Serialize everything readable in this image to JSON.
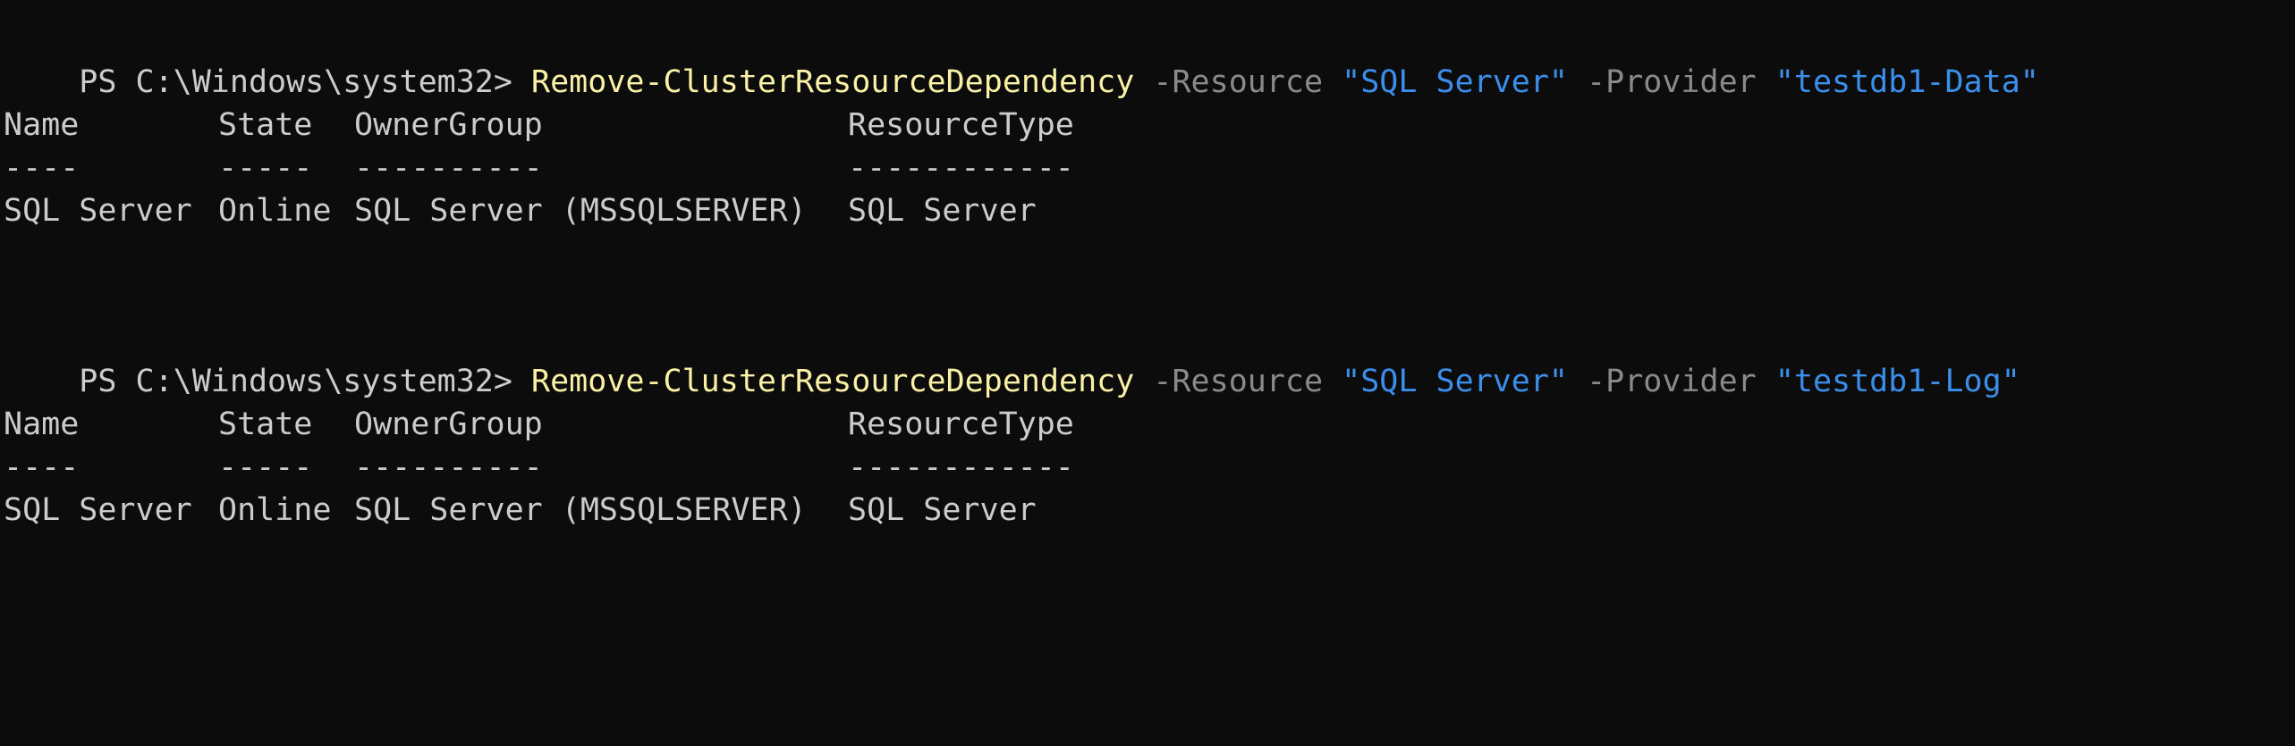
{
  "theme": {
    "background": "#0c0c0c",
    "text": "#cccccc",
    "command": "#f9f1a5",
    "parameter": "#8a8a8a",
    "string": "#3b8eea"
  },
  "blocks": [
    {
      "prompt": "PS C:\\Windows\\system32>",
      "command": "Remove-ClusterResourceDependency",
      "param1": "-Resource",
      "arg1": "\"SQL Server\"",
      "param2": "-Provider",
      "arg2": "\"testdb1-Data\"",
      "headers": [
        "Name",
        "State",
        "OwnerGroup",
        "ResourceType"
      ],
      "dashes": [
        "----",
        "-----",
        "----------",
        "------------"
      ],
      "row": [
        "SQL Server",
        "Online",
        "SQL Server (MSSQLSERVER)",
        "SQL Server"
      ]
    },
    {
      "prompt": "PS C:\\Windows\\system32>",
      "command": "Remove-ClusterResourceDependency",
      "param1": "-Resource",
      "arg1": "\"SQL Server\"",
      "param2": "-Provider",
      "arg2": "\"testdb1-Log\"",
      "headers": [
        "Name",
        "State",
        "OwnerGroup",
        "ResourceType"
      ],
      "dashes": [
        "----",
        "-----",
        "----------",
        "------------"
      ],
      "row": [
        "SQL Server",
        "Online",
        "SQL Server (MSSQLSERVER)",
        "SQL Server"
      ]
    }
  ]
}
